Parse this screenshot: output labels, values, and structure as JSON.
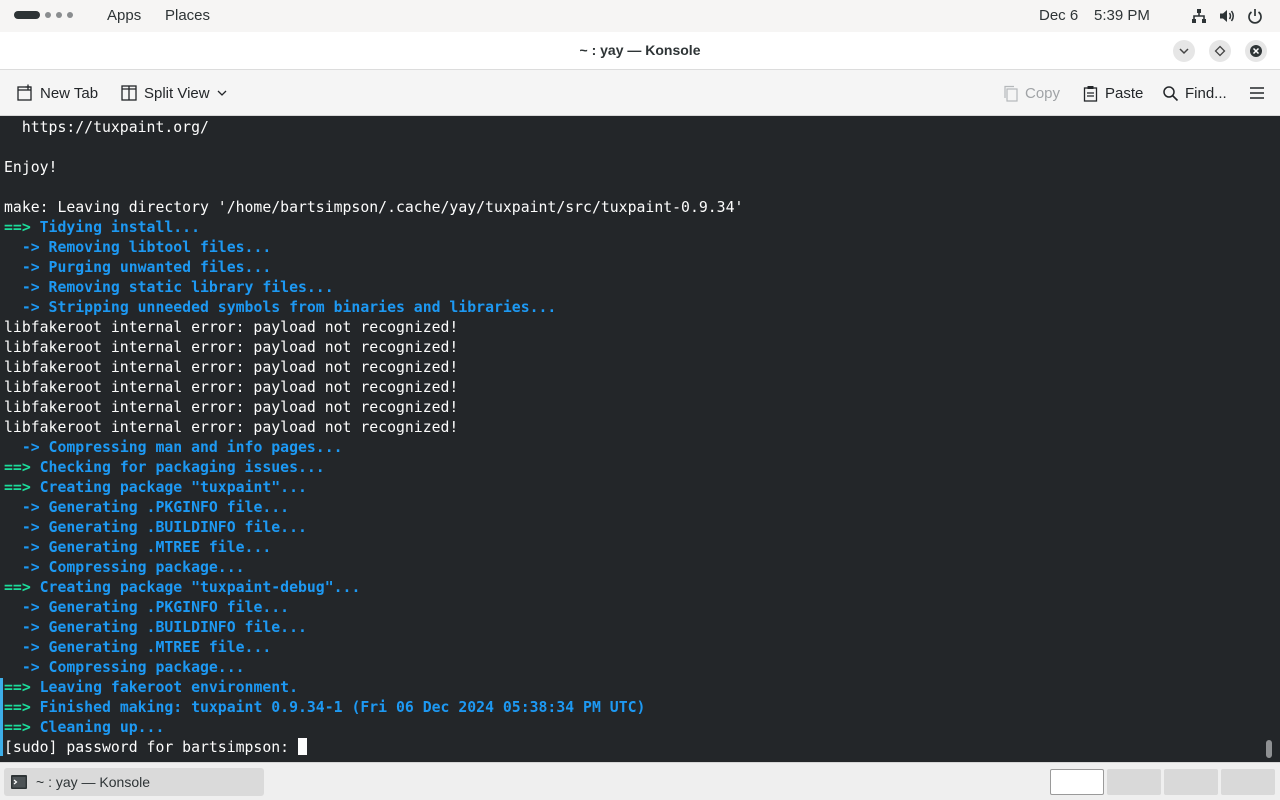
{
  "topbar": {
    "apps_label": "Apps",
    "places_label": "Places",
    "date": "Dec 6",
    "time": "5:39 PM",
    "icons": [
      "network-icon",
      "volume-icon",
      "power-icon"
    ]
  },
  "window": {
    "title": "~ : yay — Konsole"
  },
  "toolbar": {
    "new_tab_label": "New Tab",
    "split_view_label": "Split View",
    "copy_label": "Copy",
    "paste_label": "Paste",
    "find_label": "Find..."
  },
  "terminal": {
    "lines": [
      {
        "text": "  https://tuxpaint.org/",
        "style": "white"
      },
      {
        "text": "",
        "style": "white"
      },
      {
        "text": "Enjoy!",
        "style": "white"
      },
      {
        "text": "",
        "style": "white"
      },
      {
        "text": "make: Leaving directory '/home/bartsimpson/.cache/yay/tuxpaint/src/tuxpaint-0.9.34'",
        "style": "white"
      },
      {
        "prefix": "==>",
        "text": " Tidying install...",
        "style": "green"
      },
      {
        "prefix": "  ->",
        "text": " Removing libtool files...",
        "style": "blue"
      },
      {
        "prefix": "  ->",
        "text": " Purging unwanted files...",
        "style": "blue"
      },
      {
        "prefix": "  ->",
        "text": " Removing static library files...",
        "style": "blue"
      },
      {
        "prefix": "  ->",
        "text": " Stripping unneeded symbols from binaries and libraries...",
        "style": "blue"
      },
      {
        "text": "libfakeroot internal error: payload not recognized!",
        "style": "white"
      },
      {
        "text": "libfakeroot internal error: payload not recognized!",
        "style": "white"
      },
      {
        "text": "libfakeroot internal error: payload not recognized!",
        "style": "white"
      },
      {
        "text": "libfakeroot internal error: payload not recognized!",
        "style": "white"
      },
      {
        "text": "libfakeroot internal error: payload not recognized!",
        "style": "white"
      },
      {
        "text": "libfakeroot internal error: payload not recognized!",
        "style": "white"
      },
      {
        "prefix": "  ->",
        "text": " Compressing man and info pages...",
        "style": "blue"
      },
      {
        "prefix": "==>",
        "text": " Checking for packaging issues...",
        "style": "green"
      },
      {
        "prefix": "==>",
        "text": " Creating package \"tuxpaint\"...",
        "style": "green"
      },
      {
        "prefix": "  ->",
        "text": " Generating .PKGINFO file...",
        "style": "blue"
      },
      {
        "prefix": "  ->",
        "text": " Generating .BUILDINFO file...",
        "style": "blue"
      },
      {
        "prefix": "  ->",
        "text": " Generating .MTREE file...",
        "style": "blue"
      },
      {
        "prefix": "  ->",
        "text": " Compressing package...",
        "style": "blue"
      },
      {
        "prefix": "==>",
        "text": " Creating package \"tuxpaint-debug\"...",
        "style": "green"
      },
      {
        "prefix": "  ->",
        "text": " Generating .PKGINFO file...",
        "style": "blue"
      },
      {
        "prefix": "  ->",
        "text": " Generating .BUILDINFO file...",
        "style": "blue"
      },
      {
        "prefix": "  ->",
        "text": " Generating .MTREE file...",
        "style": "blue"
      },
      {
        "prefix": "  ->",
        "text": " Compressing package...",
        "style": "blue"
      },
      {
        "prefix": "==>",
        "text": " Leaving fakeroot environment.",
        "style": "green"
      },
      {
        "prefix": "==>",
        "text": " Finished making: tuxpaint 0.9.34-1 (Fri 06 Dec 2024 05:38:34 PM UTC)",
        "style": "green"
      },
      {
        "prefix": "==>",
        "text": " Cleaning up...",
        "style": "green"
      }
    ],
    "prompt": "[sudo] password for bartsimpson: "
  },
  "taskbar": {
    "task_label": "~ : yay — Konsole",
    "workspaces": 4,
    "active_workspace": 1
  }
}
